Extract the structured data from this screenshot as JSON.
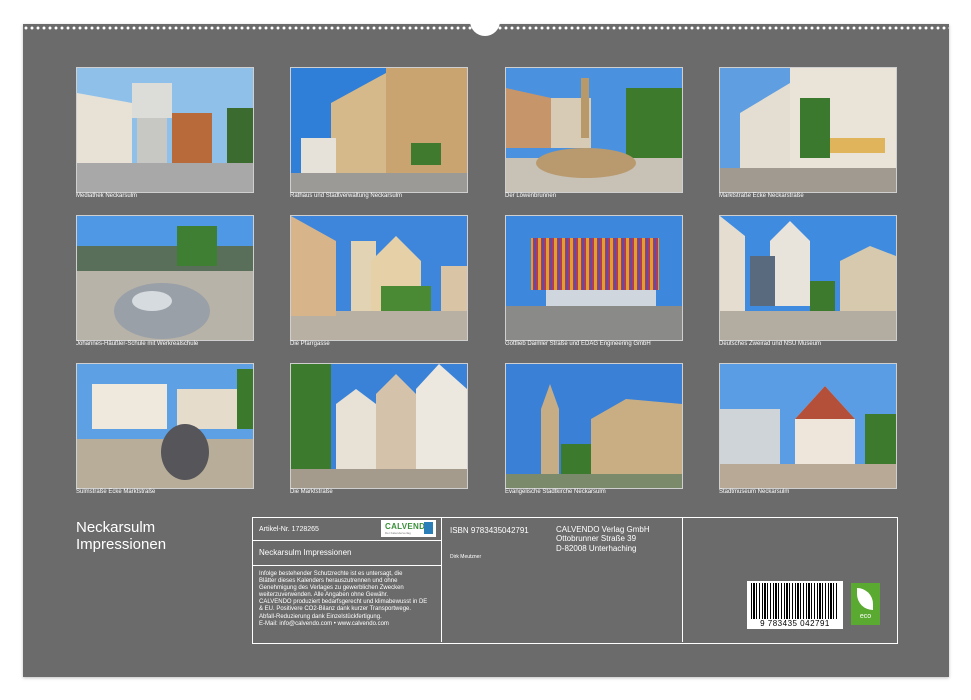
{
  "calendar": {
    "photos": [
      {
        "caption": "Mediathek Neckarsulm"
      },
      {
        "caption": "Rathaus und Stadtverwaltung Neckarsulm"
      },
      {
        "caption": "Der Löwenbrunnen"
      },
      {
        "caption": "Marktstraße Ecke Neckarstraße"
      },
      {
        "caption": "Johannes-Häußler-Schule mit Werkrealschule"
      },
      {
        "caption": "Die Pfarrgasse"
      },
      {
        "caption": "Gottlieb Daimler Straße und EDAG Engineering GmbH"
      },
      {
        "caption": "Deutsches Zweirad und NSU Museum"
      },
      {
        "caption": "Sulmstraße Ecke Marktstraße"
      },
      {
        "caption": "Die Marktstraße"
      },
      {
        "caption": "Evangelische Stadtkirche Neckarsulm"
      },
      {
        "caption": "Stadtmuseum Neckarsulm"
      }
    ],
    "title_line1": "Neckarsulm",
    "title_line2": "Impressionen",
    "article_label": "Artikel-Nr. 1728265",
    "subtitle": "Neckarsulm Impressionen",
    "legal_text": [
      "Infolge bestehender Schutzrechte ist es untersagt, die",
      "Blätter dieses Kalenders herauszutrennen und ohne",
      "Genehmigung des Verlages zu gewerblichen Zwecken",
      "weiterzuverwenden. Alle Angaben ohne Gewähr.",
      "CALVENDO produziert bedarfsgerecht und klimabewusst in DE",
      "& EU. Positivere CO2-Bilanz dank kurzer Transportwege.",
      "Abfall-Reduzierung dank Einzelstückfertigung.",
      "E-Mail: info@calvendo.com • www.calvendo.com"
    ],
    "isbn": "ISBN 9783435042791",
    "author": "Dirk Meutzner",
    "publisher": [
      "CALVENDO Verlag GmbH",
      "Ottobrunner Straße 39",
      "D-82008 Unterhaching"
    ],
    "logo_text": "CALVENDO",
    "logo_sub": "Der Kalenderverlag",
    "barcode_number": "9 783435 042791",
    "eco_label": "eco"
  }
}
